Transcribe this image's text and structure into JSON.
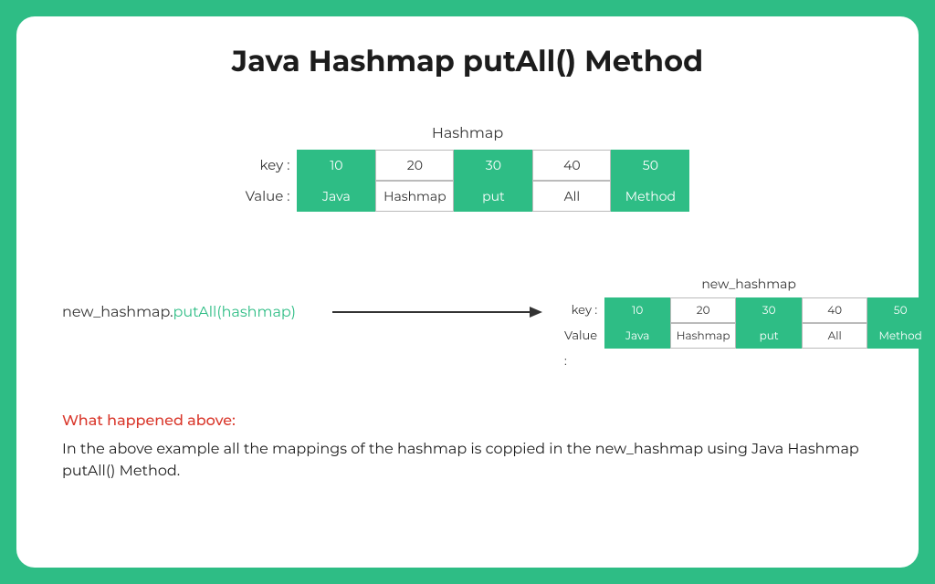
{
  "title": "Java Hashmap putAll() Method",
  "hashmap": {
    "label": "Hashmap",
    "key_label": "key :",
    "value_label": "Value :",
    "keys": [
      "10",
      "20",
      "30",
      "40",
      "50"
    ],
    "values": [
      "Java",
      "Hashmap",
      "put",
      "All",
      "Method"
    ],
    "green_indices": [
      0,
      2,
      4
    ]
  },
  "code": {
    "prefix": "new_hashmap.",
    "fn": "putAll(hashmap)"
  },
  "new_hashmap": {
    "label": "new_hashmap",
    "key_label": "key :",
    "value_label": "Value :",
    "keys": [
      "10",
      "20",
      "30",
      "40",
      "50"
    ],
    "values": [
      "Java",
      "Hashmap",
      "put",
      "All",
      "Method"
    ],
    "green_indices": [
      0,
      2,
      4
    ]
  },
  "explain": {
    "subhead": "What happened above:",
    "body": "In the above example all the mappings of the hashmap is coppied in the new_hashmap using Java Hashmap putAll() Method."
  },
  "colors": {
    "accent": "#2ebd85",
    "error": "#d9372b"
  }
}
